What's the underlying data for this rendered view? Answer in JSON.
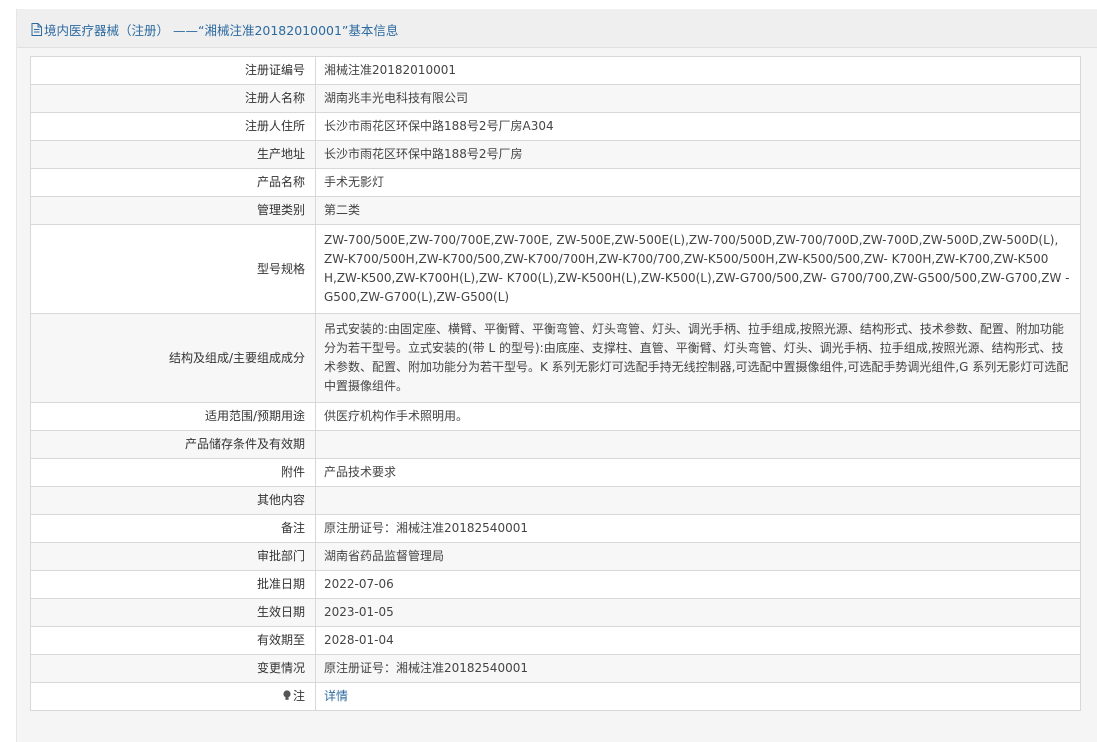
{
  "header": {
    "title": "境内医疗器械（注册） ——“湘械注准20182010001”基本信息",
    "icon": "document-icon"
  },
  "rows": [
    {
      "label": "注册证编号",
      "value": "湘械注准20182010001"
    },
    {
      "label": "注册人名称",
      "value": "湖南兆丰光电科技有限公司"
    },
    {
      "label": "注册人住所",
      "value": "长沙市雨花区环保中路188号2号厂房A304"
    },
    {
      "label": "生产地址",
      "value": "长沙市雨花区环保中路188号2号厂房"
    },
    {
      "label": "产品名称",
      "value": "手术无影灯"
    },
    {
      "label": "管理类别",
      "value": "第二类"
    },
    {
      "label": "型号规格",
      "value": "ZW-700/500E,ZW-700/700E,ZW-700E, ZW-500E,ZW-500E(L),ZW-700/500D,ZW-700/700D,ZW-700D,ZW-500D,ZW-500D(L), ZW-K700/500H,ZW-K700/500,ZW-K700/700H,ZW-K700/700,ZW-K500/500H,ZW-K500/500,ZW- K700H,ZW-K700,ZW-K500 H,ZW-K500,ZW-K700H(L),ZW- K700(L),ZW-K500H(L),ZW-K500(L),ZW-G700/500,ZW- G700/700,ZW-G500/500,ZW-G700,ZW -G500,ZW-G700(L),ZW-G500(L)"
    },
    {
      "label": "结构及组成/主要组成成分",
      "value": "吊式安装的:由固定座、横臂、平衡臂、平衡弯管、灯头弯管、灯头、调光手柄、拉手组成,按照光源、结构形式、技术参数、配置、附加功能分为若干型号。立式安装的(带 L 的型号):由底座、支撑柱、直管、平衡臂、灯头弯管、灯头、调光手柄、拉手组成,按照光源、结构形式、技术参数、配置、附加功能分为若干型号。K 系列无影灯可选配手持无线控制器,可选配中置摄像组件,可选配手势调光组件,G 系列无影灯可选配中置摄像组件。"
    },
    {
      "label": "适用范围/预期用途",
      "value": "供医疗机构作手术照明用。"
    },
    {
      "label": "产品储存条件及有效期",
      "value": ""
    },
    {
      "label": "附件",
      "value": "产品技术要求"
    },
    {
      "label": "其他内容",
      "value": ""
    },
    {
      "label": "备注",
      "value": "原注册证号：湘械注准20182540001"
    },
    {
      "label": "审批部门",
      "value": "湖南省药品监督管理局"
    },
    {
      "label": "批准日期",
      "value": "2022-07-06"
    },
    {
      "label": "生效日期",
      "value": "2023-01-05"
    },
    {
      "label": "有效期至",
      "value": "2028-01-04"
    },
    {
      "label": "变更情况",
      "value": "原注册证号：湘械注准20182540001"
    },
    {
      "label": "注",
      "value": "详情",
      "icon": "lightbulb-icon"
    }
  ],
  "colors": {
    "link": "#2c6aa0",
    "border": "#d8d8d8"
  }
}
